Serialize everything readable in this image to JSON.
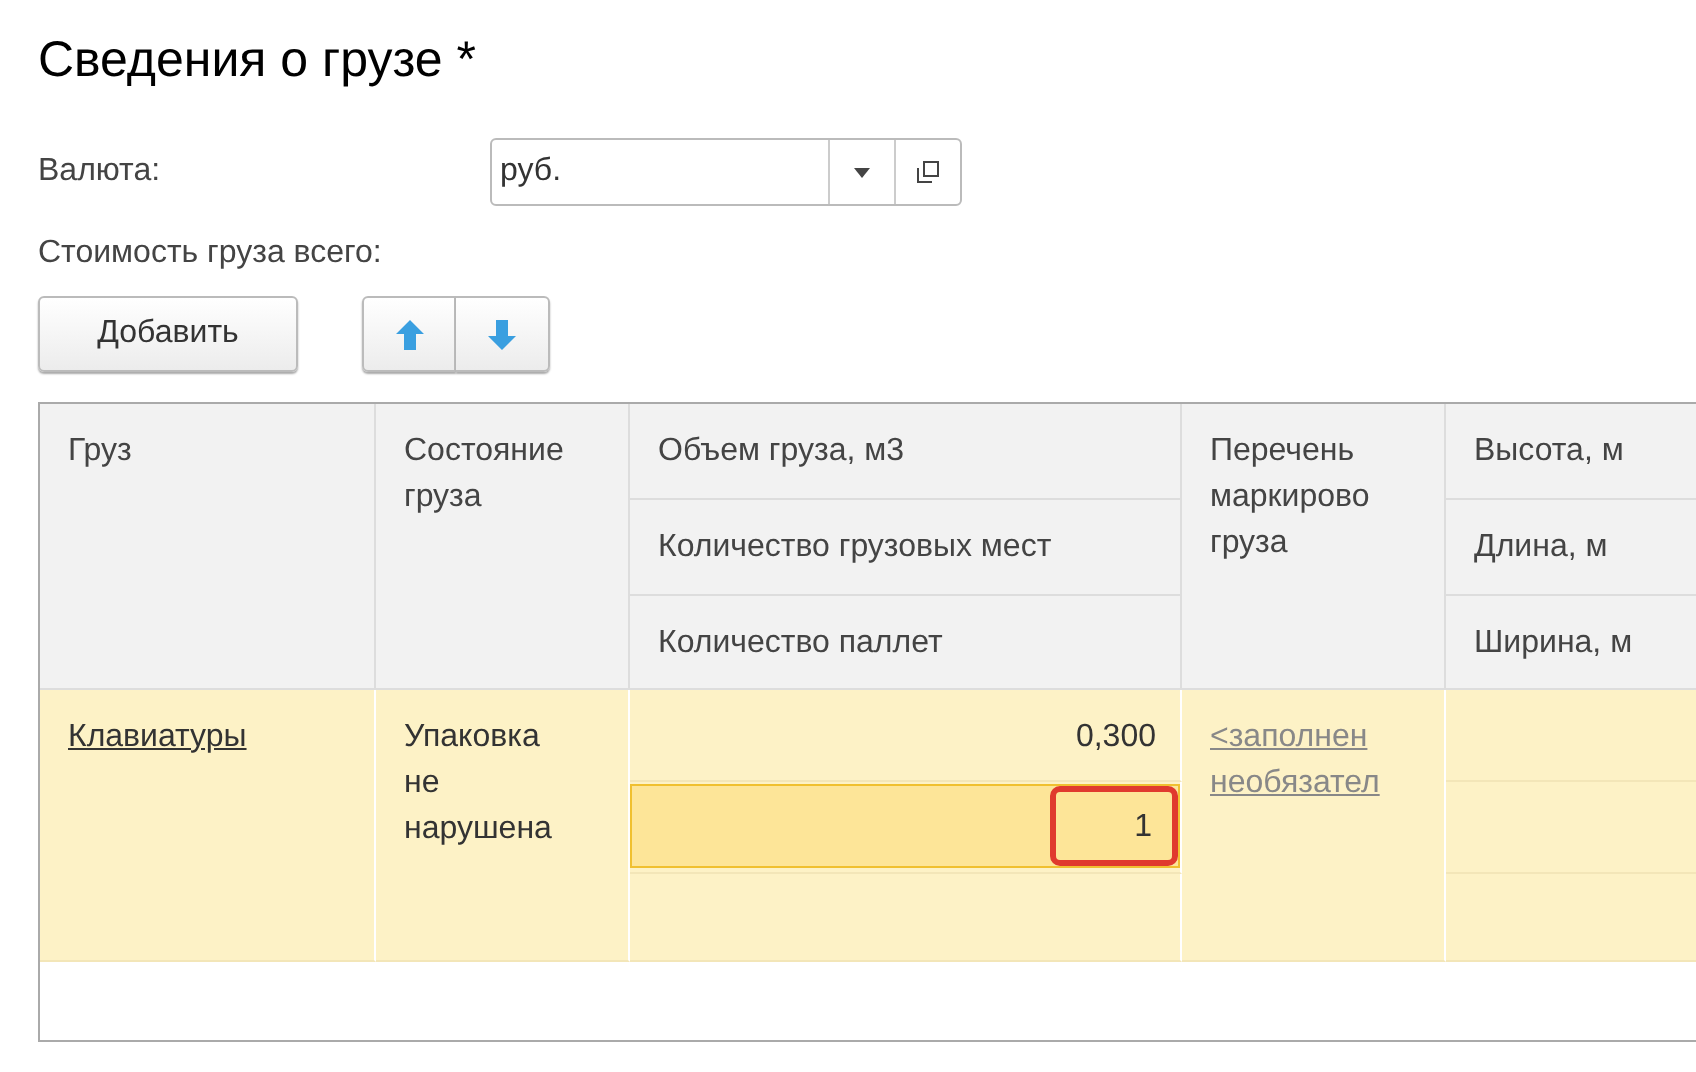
{
  "title": "Сведения о грузе *",
  "currency": {
    "label": "Валюта:",
    "value": "руб."
  },
  "total_label": "Стоимость груза всего:",
  "toolbar": {
    "add_button": "Добавить"
  },
  "table": {
    "columns": [
      {
        "header": "Груз"
      },
      {
        "header": "Состояние груза"
      },
      {
        "headers": [
          "Объем груза, м3",
          "Количество грузовых мест",
          "Количество паллет"
        ]
      },
      {
        "header": "Перечень маркирово груза"
      },
      {
        "headers": [
          "Высота, м",
          "Длина, м",
          "Ширина, м"
        ]
      }
    ],
    "rows": [
      {
        "selected": true,
        "cargo": "Клавиатуры",
        "condition": "Упаковка не нарушена",
        "volume": "0,300",
        "places": {
          "value": "1",
          "editing": true,
          "highlighted": true
        },
        "marking_link": [
          "<заполнен",
          "необязател"
        ]
      }
    ]
  }
}
